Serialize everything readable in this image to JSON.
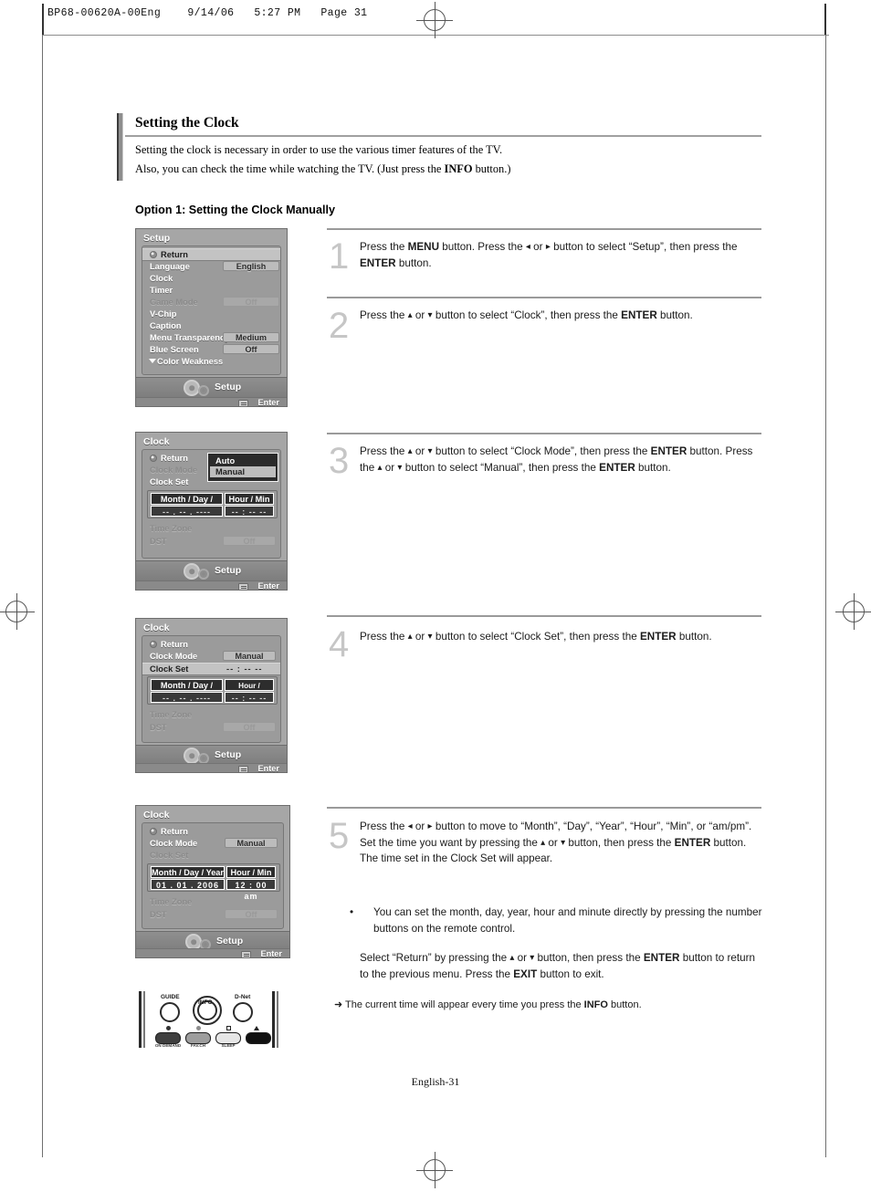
{
  "print_header": "BP68-00620A-00Eng    9/14/06   5:27 PM   Page 31",
  "section": {
    "title": "Setting the Clock",
    "desc_line1_a": "Setting the clock is necessary in order to use the various timer features of the TV.",
    "desc_line2_a": "Also, you can check the time while watching the TV. (Just press the ",
    "desc_line2_bold": "INFO",
    "desc_line2_b": " button.)",
    "option_title": "Option 1: Setting the Clock Manually"
  },
  "steps": [
    {
      "number": "1",
      "text_parts": [
        "Press the ",
        "MENU",
        " button. Press the ",
        "◂",
        " or ",
        "▸",
        " button to select “Setup”, then press the ",
        "ENTER",
        " button."
      ]
    },
    {
      "number": "2",
      "text_parts": [
        "Press the ",
        "▴",
        " or ",
        "▾",
        " button to select “Clock”, then press the ",
        "ENTER",
        " button."
      ]
    },
    {
      "number": "3",
      "text_parts": [
        "Press the ",
        "▴",
        " or ",
        "▾",
        " button to select “Clock Mode”, then press the ",
        "ENTER",
        " button. Press the ",
        "▴",
        " or ",
        "▾",
        " button to select “Manual”, then press the ",
        "ENTER",
        " button."
      ]
    },
    {
      "number": "4",
      "text_parts": [
        "Press the ",
        "▴",
        " or ",
        "▾",
        " button to select “Clock Set”, then press the ",
        "ENTER",
        " button."
      ]
    },
    {
      "number": "5",
      "text_parts": [
        "Press the ",
        "◂",
        " or ",
        "▸",
        " button to move to “Month”, “Day”, “Year”, “Hour”, “Min”, or “am/pm”. Set the time you want by pressing the ",
        "▴",
        " or ",
        "▾",
        " button, then press the ",
        "ENTER",
        " button. The time set in the Clock Set will appear."
      ]
    }
  ],
  "notes": {
    "bullet_symbol": "•",
    "bullet_text": "You can set the month, day, year, hour and minute directly by pressing the number buttons on the remote control.",
    "return_note_a": "Select “Return” by pressing the ",
    "return_note_up": "▴",
    "return_note_or": " or ",
    "return_note_down": "▾",
    "return_note_b": " button, then press the ",
    "return_note_enter": "ENTER",
    "return_note_c": " button to return to the previous menu. Press the ",
    "return_note_exit": "EXIT",
    "return_note_d": " button to exit.",
    "arrow_symbol": "➜",
    "arrow_note_a": "The current time will appear every time you press the ",
    "arrow_note_bold": "INFO",
    "arrow_note_b": " button."
  },
  "osd_setup": {
    "title": "Setup",
    "rows": [
      {
        "label": "Return",
        "value": null,
        "state": "selected",
        "icon": "return-icon"
      },
      {
        "label": "Language",
        "value": "English",
        "state": "normal"
      },
      {
        "label": "Clock",
        "value": null,
        "state": "normal"
      },
      {
        "label": "Timer",
        "value": null,
        "state": "normal"
      },
      {
        "label": "Game Mode",
        "value": "Off",
        "state": "disabled"
      },
      {
        "label": "V-Chip",
        "value": null,
        "state": "normal"
      },
      {
        "label": "Caption",
        "value": null,
        "state": "normal"
      },
      {
        "label": "Menu Transparency",
        "value": "Medium",
        "state": "normal"
      },
      {
        "label": "Blue Screen",
        "value": "Off",
        "state": "normal"
      },
      {
        "label": "Color Weakness",
        "value": null,
        "state": "normal",
        "icon": "chevron-down-icon"
      }
    ],
    "footer_label": "Setup",
    "enter_label": "Enter"
  },
  "osd_clock_mode": {
    "title": "Clock",
    "rows": [
      {
        "label": "Return",
        "value": null,
        "state": "normal",
        "icon": "return-icon"
      },
      {
        "label": "Clock Mode",
        "value": null,
        "state": "disabled"
      },
      {
        "label": "Clock Set",
        "value": null,
        "state": "normal"
      }
    ],
    "dropdown": {
      "options": [
        "Auto",
        "Manual"
      ],
      "selected": "Manual"
    },
    "table": {
      "headers": [
        "Month / Day / Year",
        "Hour / Min"
      ],
      "values": [
        "--  .  --  .  ----",
        "--  :  --    --"
      ]
    },
    "time_zone_label": "Time Zone",
    "dst_label": "DST",
    "dst_value": "Off",
    "footer_label": "Setup",
    "enter_label": "Enter"
  },
  "osd_clock_set": {
    "title": "Clock",
    "rows": [
      {
        "label": "Return",
        "value": null,
        "state": "normal",
        "icon": "return-icon"
      },
      {
        "label": "Clock Mode",
        "value": "Manual",
        "state": "normal"
      },
      {
        "label": "Clock Set",
        "value": "--  :  --  --",
        "state": "selected"
      }
    ],
    "table": {
      "headers": [
        "Month / Day / Year",
        "Hour / Minute"
      ],
      "values": [
        "--  .  --  .  ----",
        "--  :  --    --"
      ]
    },
    "time_zone_label": "Time Zone",
    "dst_label": "DST",
    "dst_value": "Off",
    "footer_label": "Setup",
    "enter_label": "Enter"
  },
  "osd_clock_filled": {
    "title": "Clock",
    "rows": [
      {
        "label": "Return",
        "value": null,
        "state": "normal",
        "icon": "return-icon"
      },
      {
        "label": "Clock Mode",
        "value": "Manual",
        "state": "normal"
      },
      {
        "label": "Clock Set",
        "value": null,
        "state": "disabled"
      }
    ],
    "table": {
      "headers": [
        "Month / Day / Year",
        "Hour / Min"
      ],
      "values": [
        "01  .  01  .  2006",
        "12 : 00    am"
      ]
    },
    "time_zone_label": "Time Zone",
    "dst_label": "DST",
    "dst_value": "Off",
    "footer_label": "Setup",
    "enter_label": "Enter"
  },
  "remote": {
    "buttons": [
      {
        "label": "GUIDE",
        "sub": "ON DEMAND"
      },
      {
        "label": "INFO",
        "sub": "FAV.CH"
      },
      {
        "label": "D-Net",
        "sub": "SLEEP"
      },
      {
        "label": "",
        "sub": ""
      }
    ],
    "key_sublabels": [
      "ON DEMAND",
      "FAV.CH",
      "SLEEP",
      ""
    ]
  },
  "footer": {
    "page_label": "English-31"
  }
}
